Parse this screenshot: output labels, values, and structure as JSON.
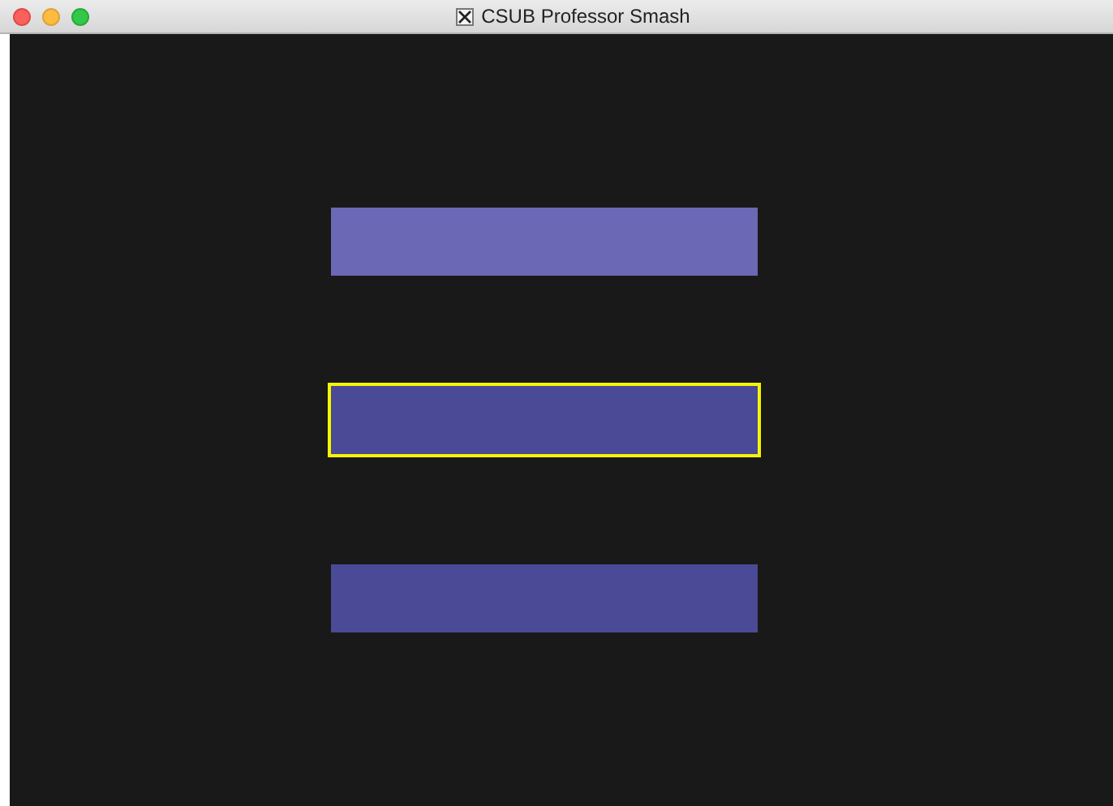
{
  "window": {
    "title": "CSUB Professor Smash"
  },
  "buttons": [
    {
      "selected": false,
      "color": "#6b68b5"
    },
    {
      "selected": true,
      "color": "#4b4a96"
    },
    {
      "selected": false,
      "color": "#4b4a96"
    }
  ]
}
